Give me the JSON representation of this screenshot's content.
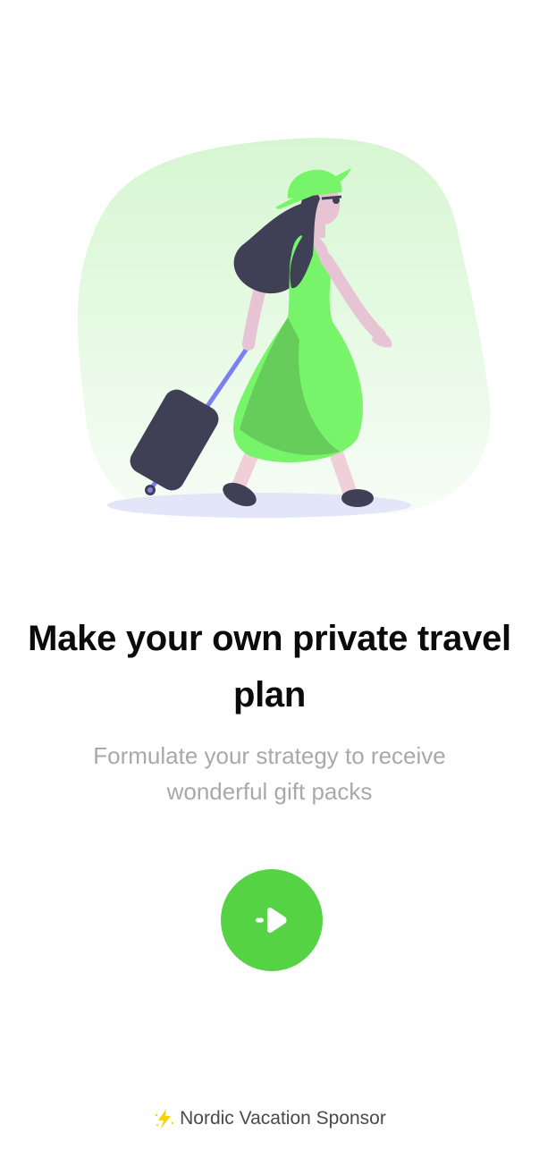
{
  "onboarding": {
    "illustration": "woman-traveler-with-suitcase",
    "title": "Make your own private travel plan",
    "subtitle": "Formulate your strategy to receive wonderful gift packs",
    "next_button_icon": "arrow-right-icon",
    "accent_color": "#56d245"
  },
  "footer": {
    "sponsor_icon": "lightning-icon",
    "sponsor_label": "Nordic Vacation Sponsor"
  }
}
